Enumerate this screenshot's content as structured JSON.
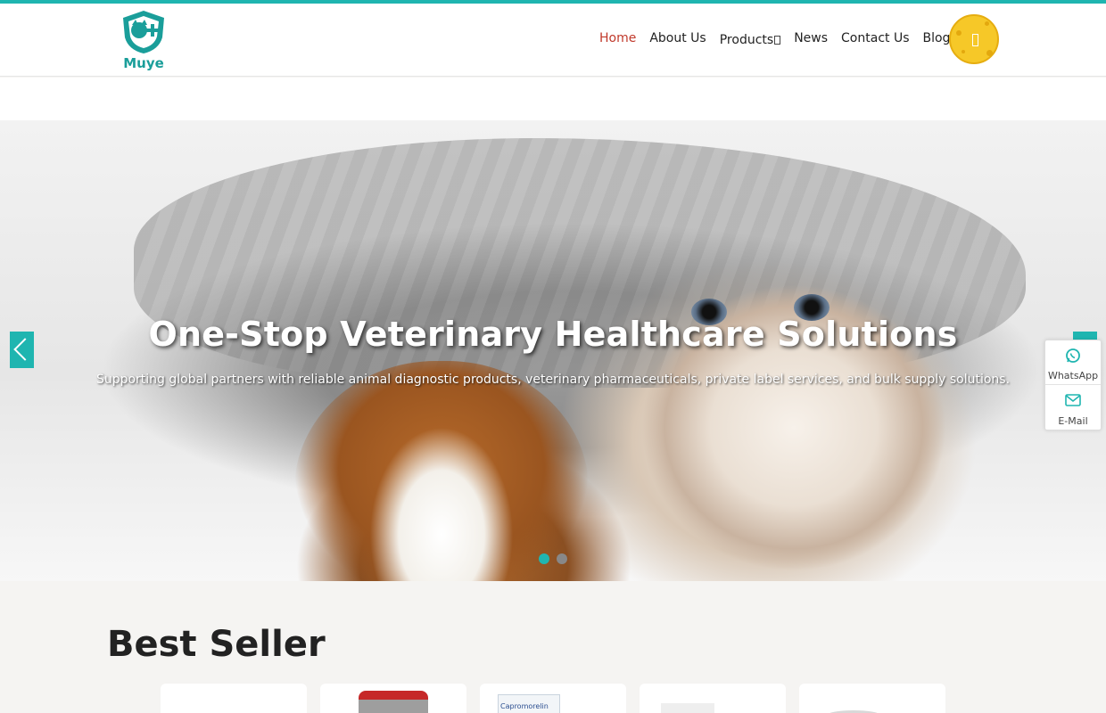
{
  "brand": {
    "name": "Muye",
    "accent_color": "#1fb5b0",
    "active_nav_color": "#c0392b",
    "search_button_color": "#f6c828"
  },
  "nav": {
    "items": [
      {
        "label": "Home",
        "active": true
      },
      {
        "label": "About Us",
        "active": false
      },
      {
        "label": "Products",
        "active": false,
        "has_dropdown": true
      },
      {
        "label": "News",
        "active": false
      },
      {
        "label": "Contact Us",
        "active": false
      },
      {
        "label": "Blog",
        "active": false
      }
    ],
    "search_icon": "search-icon"
  },
  "hero": {
    "title": "One-Stop Veterinary Healthcare Solutions",
    "subtitle": "Supporting global partners with reliable animal diagnostic products, veterinary pharmaceuticals, private label services, and bulk supply solutions.",
    "slides_total": 2,
    "active_slide": 1,
    "prev_icon": "chevron-left-icon",
    "next_icon": "chevron-right-icon"
  },
  "side_contact": {
    "whatsapp_label": "WhatsApp",
    "email_label": "E-Mail"
  },
  "best_seller": {
    "title": "Best Seller",
    "products": [
      {
        "image_label": ""
      },
      {
        "image_label": ""
      },
      {
        "image_label": "Capromorelin"
      },
      {
        "image_label": ""
      },
      {
        "image_label": ""
      }
    ]
  }
}
